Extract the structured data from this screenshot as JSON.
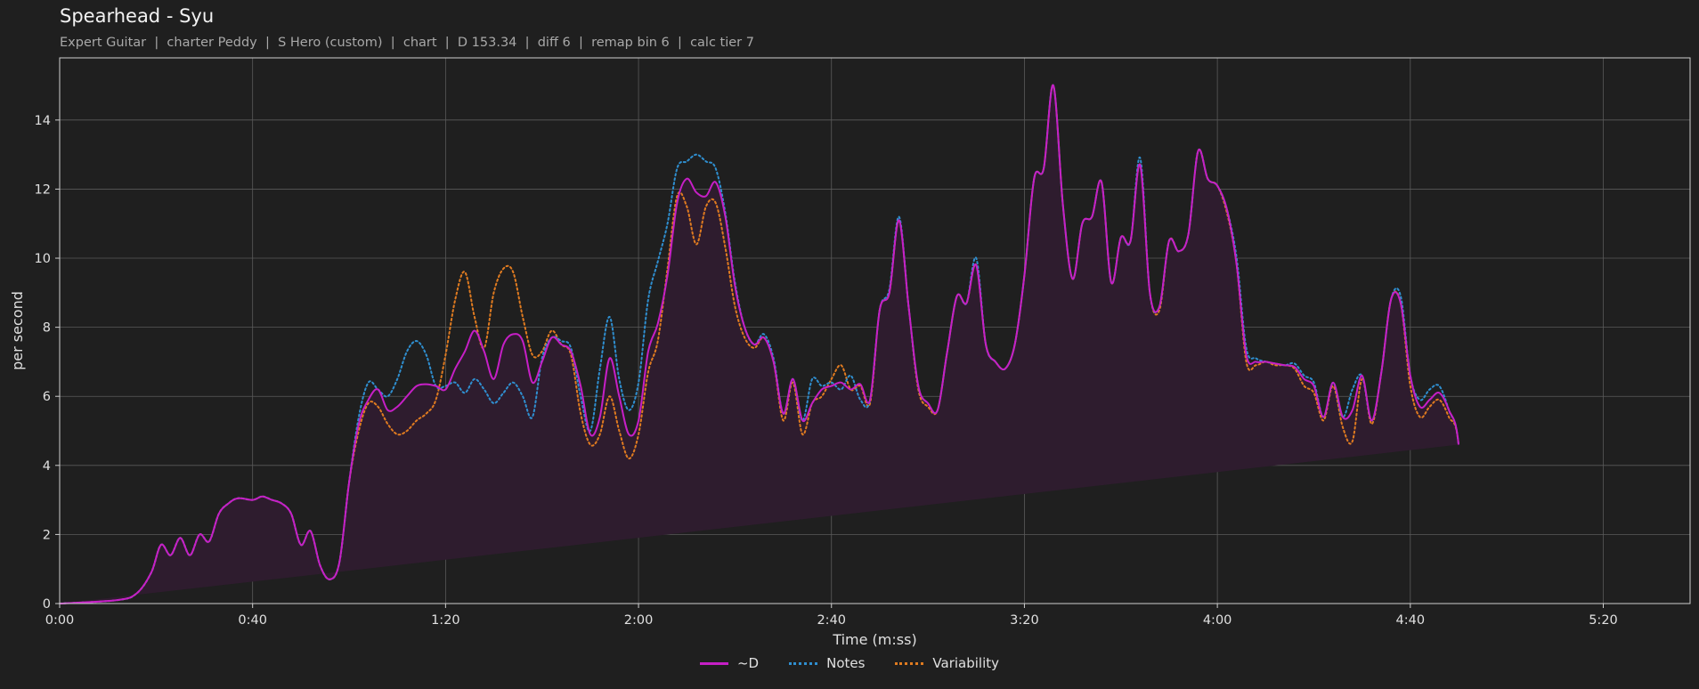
{
  "title": "Spearhead - Syu",
  "subtitle": "Expert Guitar  |  charter Peddy  |  S Hero (custom)  |  chart  |  D 153.34  |  diff 6  |  remap bin 6  |  calc tier 7",
  "colors": {
    "background": "#1f1f1f",
    "grid": "#5a5a5a",
    "axes": "#cfcfcf",
    "d": "#c61fc6",
    "notes": "#2f8fd0",
    "variability": "#e07b20",
    "fill": "#2e1c2e"
  },
  "chart_data": {
    "type": "line",
    "title": "Spearhead - Syu",
    "xlabel": "Time (m:ss)",
    "ylabel": "per second",
    "xlim": [
      0,
      338
    ],
    "ylim": [
      0,
      15.8
    ],
    "grid": true,
    "legend_position": "bottom-center",
    "x_ticks": [
      {
        "value": 0,
        "label": "0:00"
      },
      {
        "value": 40,
        "label": "0:40"
      },
      {
        "value": 80,
        "label": "1:20"
      },
      {
        "value": 120,
        "label": "2:00"
      },
      {
        "value": 160,
        "label": "2:40"
      },
      {
        "value": 200,
        "label": "3:20"
      },
      {
        "value": 240,
        "label": "4:00"
      },
      {
        "value": 280,
        "label": "4:40"
      },
      {
        "value": 320,
        "label": "5:20"
      }
    ],
    "y_ticks": [
      {
        "value": 0,
        "label": "0"
      },
      {
        "value": 2,
        "label": "2"
      },
      {
        "value": 4,
        "label": "4"
      },
      {
        "value": 6,
        "label": "6"
      },
      {
        "value": 8,
        "label": "8"
      },
      {
        "value": 10,
        "label": "10"
      },
      {
        "value": 12,
        "label": "12"
      },
      {
        "value": 14,
        "label": "14"
      }
    ],
    "x": [
      0,
      12,
      16,
      19,
      21,
      23,
      25,
      27,
      29,
      31,
      33,
      35,
      37,
      40,
      42,
      44,
      46,
      48,
      50,
      52,
      54,
      56,
      58,
      60,
      62,
      64,
      66,
      68,
      70,
      72,
      74,
      76,
      78,
      80,
      82,
      84,
      86,
      88,
      90,
      92,
      94,
      96,
      98,
      100,
      102,
      104,
      106,
      108,
      110,
      112,
      114,
      116,
      118,
      120,
      122,
      124,
      126,
      128,
      130,
      132,
      134,
      136,
      138,
      140,
      142,
      144,
      146,
      148,
      150,
      152,
      154,
      156,
      158,
      160,
      162,
      164,
      166,
      168,
      170,
      172,
      174,
      176,
      178,
      180,
      182,
      184,
      186,
      188,
      190,
      192,
      194,
      196,
      198,
      200,
      202,
      204,
      206,
      208,
      210,
      212,
      214,
      216,
      218,
      220,
      222,
      224,
      226,
      228,
      230,
      232,
      234,
      236,
      238,
      240,
      242,
      244,
      246,
      248,
      250,
      252,
      254,
      256,
      258,
      260,
      262,
      264,
      266,
      268,
      270,
      272,
      274,
      276,
      278,
      280,
      282,
      284,
      286,
      288,
      290,
      292,
      294,
      296,
      298,
      300,
      302,
      304,
      306,
      308,
      310,
      312,
      314,
      316,
      318,
      320,
      322,
      324,
      326,
      328,
      330,
      332,
      334,
      336,
      338
    ],
    "series": [
      {
        "name": "~D",
        "style": "solid",
        "values": [
          0,
          0.1,
          0.3,
          0.9,
          1.7,
          1.4,
          1.9,
          1.4,
          2.0,
          1.8,
          2.6,
          2.9,
          3.05,
          3.0,
          3.1,
          3.0,
          2.9,
          2.6,
          1.7,
          2.1,
          1.1,
          0.7,
          1.2,
          3.5,
          5.2,
          5.9,
          6.2,
          5.6,
          5.7,
          6.0,
          6.3,
          6.35,
          6.3,
          6.2,
          6.8,
          7.3,
          7.9,
          7.3,
          6.5,
          7.5,
          7.8,
          7.6,
          6.4,
          7.0,
          7.7,
          7.5,
          7.3,
          6.3,
          4.9,
          5.4,
          7.1,
          6.0,
          4.9,
          5.3,
          7.3,
          8.1,
          9.5,
          11.6,
          12.3,
          11.9,
          11.8,
          12.2,
          11.2,
          9.2,
          8.0,
          7.5,
          7.7,
          7.0,
          5.5,
          6.5,
          5.3,
          5.8,
          6.2,
          6.3,
          6.4,
          6.2,
          6.35,
          5.9,
          8.5,
          9.0,
          11.1,
          8.6,
          6.3,
          5.8,
          5.6,
          7.3,
          8.9,
          8.7,
          9.8,
          7.5,
          7.0,
          6.8,
          7.5,
          9.5,
          12.3,
          12.6,
          15.0,
          11.5,
          9.4,
          11.0,
          11.2,
          12.2,
          9.3,
          10.6,
          10.5,
          12.7,
          9.0,
          8.6,
          10.5,
          10.2,
          10.7,
          13.1,
          12.3,
          12.1,
          11.4,
          9.8,
          7.2,
          7.0,
          7.0,
          6.95,
          6.9,
          6.85,
          6.5,
          6.3,
          5.4,
          6.4,
          5.4,
          5.6,
          6.6,
          5.3,
          6.7,
          8.8,
          8.7,
          6.6,
          5.7,
          5.9,
          6.1,
          5.6,
          4.6,
          0.3
        ]
      },
      {
        "name": "Notes",
        "style": "dotted",
        "values": [
          0,
          0.1,
          0.3,
          0.9,
          1.7,
          1.4,
          1.9,
          1.4,
          2.0,
          1.8,
          2.6,
          2.9,
          3.05,
          3.0,
          3.1,
          3.0,
          2.9,
          2.6,
          1.7,
          2.1,
          1.1,
          0.7,
          1.2,
          3.5,
          5.4,
          6.4,
          6.2,
          6.0,
          6.5,
          7.3,
          7.6,
          7.2,
          6.3,
          6.3,
          6.4,
          6.1,
          6.5,
          6.2,
          5.8,
          6.1,
          6.4,
          6.0,
          5.4,
          7.1,
          7.7,
          7.6,
          7.4,
          6.0,
          5.0,
          6.8,
          8.3,
          6.5,
          5.6,
          6.4,
          8.8,
          9.9,
          11.0,
          12.6,
          12.8,
          13.0,
          12.8,
          12.6,
          11.3,
          9.3,
          8.0,
          7.5,
          7.8,
          7.1,
          5.5,
          6.5,
          5.3,
          6.5,
          6.3,
          6.4,
          6.2,
          6.6,
          5.9,
          5.9,
          8.5,
          9.1,
          11.2,
          8.6,
          6.3,
          5.8,
          5.6,
          7.3,
          8.9,
          8.7,
          10.0,
          7.5,
          7.0,
          6.8,
          7.5,
          9.5,
          12.3,
          12.6,
          15.0,
          11.5,
          9.4,
          11.0,
          11.2,
          12.2,
          9.3,
          10.6,
          10.5,
          12.9,
          9.0,
          8.6,
          10.5,
          10.2,
          10.7,
          13.1,
          12.3,
          12.1,
          11.4,
          10.0,
          7.4,
          7.1,
          7.0,
          6.95,
          6.9,
          6.95,
          6.6,
          6.4,
          5.4,
          6.4,
          5.4,
          6.2,
          6.6,
          5.3,
          6.7,
          8.8,
          8.9,
          6.6,
          5.9,
          6.2,
          6.3,
          5.6,
          4.6,
          0.3
        ]
      },
      {
        "name": "Variability",
        "style": "dotted",
        "values": [
          0,
          0.1,
          0.3,
          0.9,
          1.7,
          1.4,
          1.9,
          1.4,
          2.0,
          1.8,
          2.6,
          2.9,
          3.05,
          3.0,
          3.1,
          3.0,
          2.9,
          2.6,
          1.7,
          2.1,
          1.1,
          0.7,
          1.2,
          3.5,
          5.0,
          5.8,
          5.7,
          5.2,
          4.9,
          5.0,
          5.3,
          5.5,
          5.9,
          7.2,
          8.8,
          9.6,
          8.3,
          7.4,
          9.0,
          9.7,
          9.6,
          8.3,
          7.2,
          7.3,
          7.9,
          7.5,
          7.2,
          5.5,
          4.6,
          4.9,
          6.0,
          5.0,
          4.2,
          4.9,
          6.7,
          7.6,
          9.7,
          11.8,
          11.5,
          10.4,
          11.5,
          11.6,
          10.3,
          8.6,
          7.7,
          7.4,
          7.7,
          7.0,
          5.3,
          6.4,
          4.9,
          5.8,
          6.0,
          6.5,
          6.9,
          6.2,
          6.3,
          5.8,
          8.5,
          9.0,
          11.1,
          8.6,
          6.2,
          5.7,
          5.6,
          7.3,
          8.9,
          8.7,
          9.8,
          7.5,
          7.0,
          6.8,
          7.5,
          9.5,
          12.3,
          12.6,
          15.0,
          11.5,
          9.4,
          11.0,
          11.2,
          12.2,
          9.3,
          10.6,
          10.5,
          12.7,
          9.0,
          8.5,
          10.5,
          10.2,
          10.7,
          13.1,
          12.3,
          12.1,
          11.3,
          9.8,
          7.0,
          6.9,
          7.0,
          6.9,
          6.9,
          6.8,
          6.3,
          6.1,
          5.3,
          6.3,
          5.1,
          4.7,
          6.5,
          5.2,
          6.7,
          8.8,
          8.7,
          6.3,
          5.4,
          5.7,
          5.9,
          5.4,
          4.6,
          0.3
        ]
      }
    ]
  }
}
